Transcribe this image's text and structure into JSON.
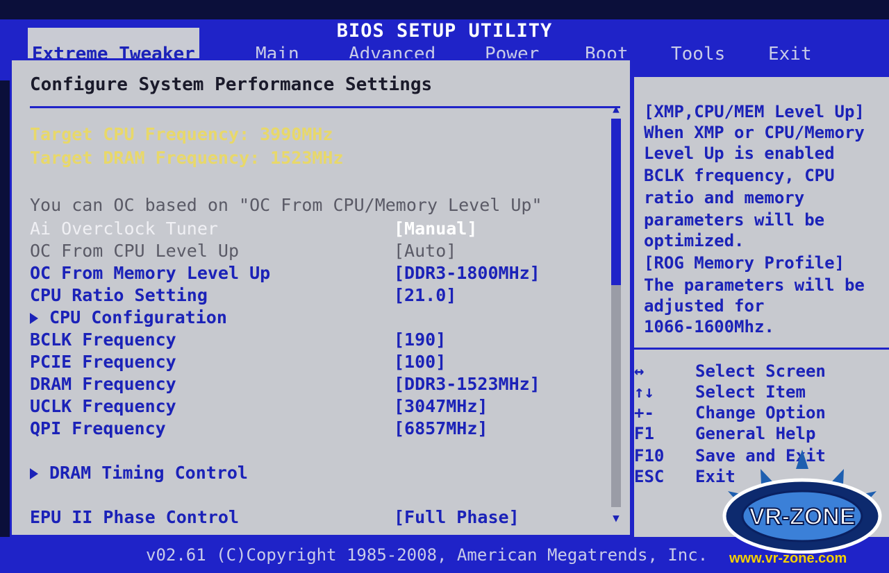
{
  "title": "BIOS SETUP UTILITY",
  "menu": [
    {
      "label": "Extreme Tweaker",
      "active": true
    },
    {
      "label": "Main"
    },
    {
      "label": "Advanced"
    },
    {
      "label": "Power"
    },
    {
      "label": "Boot"
    },
    {
      "label": "Tools"
    },
    {
      "label": "Exit"
    }
  ],
  "main": {
    "section_title": "Configure System Performance Settings",
    "target_cpu": "Target CPU Frequency: 3990MHz",
    "target_dram": "Target DRAM Frequency: 1523MHz",
    "note": "You can OC based on \"OC From CPU/Memory Level Up\"",
    "settings": [
      {
        "label": "Ai Overclock Tuner",
        "value": "[Manual]"
      },
      {
        "label": "OC From CPU Level Up",
        "value": "[Auto]"
      },
      {
        "label": "OC From Memory Level Up",
        "value": "[DDR3-1800MHz]"
      },
      {
        "label": "CPU Ratio Setting",
        "value": "[21.0]"
      },
      {
        "label": "CPU Configuration",
        "value": ""
      },
      {
        "label": "BCLK Frequency",
        "value": "[190]"
      },
      {
        "label": "PCIE Frequency",
        "value": "[100]"
      },
      {
        "label": "DRAM Frequency",
        "value": "[DDR3-1523MHz]"
      },
      {
        "label": "UCLK Frequency",
        "value": "[3047MHz]"
      },
      {
        "label": "QPI Frequency",
        "value": "[6857MHz]"
      },
      {
        "label": "DRAM Timing Control",
        "value": ""
      },
      {
        "label": "EPU II Phase Control",
        "value": "[Full Phase]"
      }
    ]
  },
  "help": {
    "lines": [
      "[XMP,CPU/MEM Level Up]",
      "When XMP or CPU/Memory",
      "Level Up is enabled",
      "BCLK frequency, CPU",
      "ratio and memory",
      "parameters will be",
      "optimized.",
      "[ROG Memory Profile]",
      "The parameters will be",
      "adjusted for",
      "1066-1600Mhz."
    ],
    "keys": [
      {
        "key": "↔",
        "desc": "Select Screen"
      },
      {
        "key": "↑↓",
        "desc": "Select Item"
      },
      {
        "key": "+-",
        "desc": "Change Option"
      },
      {
        "key": "F1",
        "desc": "General Help"
      },
      {
        "key": "F10",
        "desc": "Save and Exit"
      },
      {
        "key": "ESC",
        "desc": "Exit"
      }
    ]
  },
  "status": "v02.61 (C)Copyright 1985-2008, American Megatrends, Inc.",
  "logo": {
    "text": "VR-ZONE",
    "url": "www.vr-zone.com"
  },
  "colors": {
    "bios_blue": "#1f23c8",
    "panel_gray": "#c7c9cf",
    "highlight_yellow": "#e8d86a",
    "text_blue": "#1b22b8"
  }
}
